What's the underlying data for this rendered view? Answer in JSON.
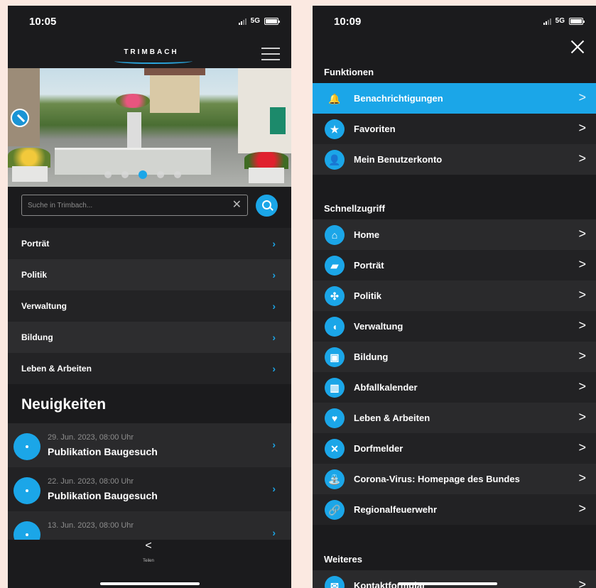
{
  "left": {
    "status": {
      "time": "10:05",
      "network": "5G"
    },
    "brand": "TRIMBACH",
    "search": {
      "placeholder": "Suche in Trimbach...",
      "clear_icon": "✕"
    },
    "carousel": {
      "count": 5,
      "active_index": 2
    },
    "nav": [
      {
        "label": "Porträt"
      },
      {
        "label": "Politik"
      },
      {
        "label": "Verwaltung"
      },
      {
        "label": "Bildung"
      },
      {
        "label": "Leben & Arbeiten"
      }
    ],
    "news_heading": "Neuigkeiten",
    "news": [
      {
        "date": "29. Jun. 2023, 08:00 Uhr",
        "title": "Publikation Baugesuch"
      },
      {
        "date": "22. Jun. 2023, 08:00 Uhr",
        "title": "Publikation Baugesuch"
      },
      {
        "date": "13. Jun. 2023, 08:00 Uhr",
        "title": ""
      }
    ],
    "share_label": "Teilen",
    "chevron": "›",
    "accent": "#1ba6e8"
  },
  "right": {
    "status": {
      "time": "10:09",
      "network": "5G"
    },
    "sections": {
      "funktionen": "Funktionen",
      "schnellzugriff": "Schnellzugriff",
      "weiteres": "Weiteres"
    },
    "funktionen": [
      {
        "label": "Benachrichtigungen",
        "icon": "bell-icon",
        "glyph": "🔔",
        "active": true
      },
      {
        "label": "Favoriten",
        "icon": "star-icon",
        "glyph": "★"
      },
      {
        "label": "Mein Benutzerkonto",
        "icon": "user-icon",
        "glyph": "👤"
      }
    ],
    "schnellzugriff": [
      {
        "label": "Home",
        "icon": "home-icon",
        "glyph": "⌂"
      },
      {
        "label": "Porträt",
        "icon": "portrait-icon",
        "glyph": "▰"
      },
      {
        "label": "Politik",
        "icon": "politics-icon",
        "glyph": "✣"
      },
      {
        "label": "Verwaltung",
        "icon": "administration-icon",
        "glyph": "◖"
      },
      {
        "label": "Bildung",
        "icon": "education-icon",
        "glyph": "▣"
      },
      {
        "label": "Abfallkalender",
        "icon": "trash-icon",
        "glyph": "▥"
      },
      {
        "label": "Leben & Arbeiten",
        "icon": "heart-icon",
        "glyph": "♥"
      },
      {
        "label": "Dorfmelder",
        "icon": "tools-icon",
        "glyph": "✕"
      },
      {
        "label": "Corona-Virus: Homepage des Bundes",
        "icon": "fountain-icon",
        "glyph": "⛲"
      },
      {
        "label": "Regionalfeuerwehr",
        "icon": "link-icon",
        "glyph": "🔗"
      }
    ],
    "weiteres": [
      {
        "label": "Kontaktformular",
        "icon": "mail-icon",
        "glyph": "✉"
      }
    ],
    "chevron": ">"
  }
}
